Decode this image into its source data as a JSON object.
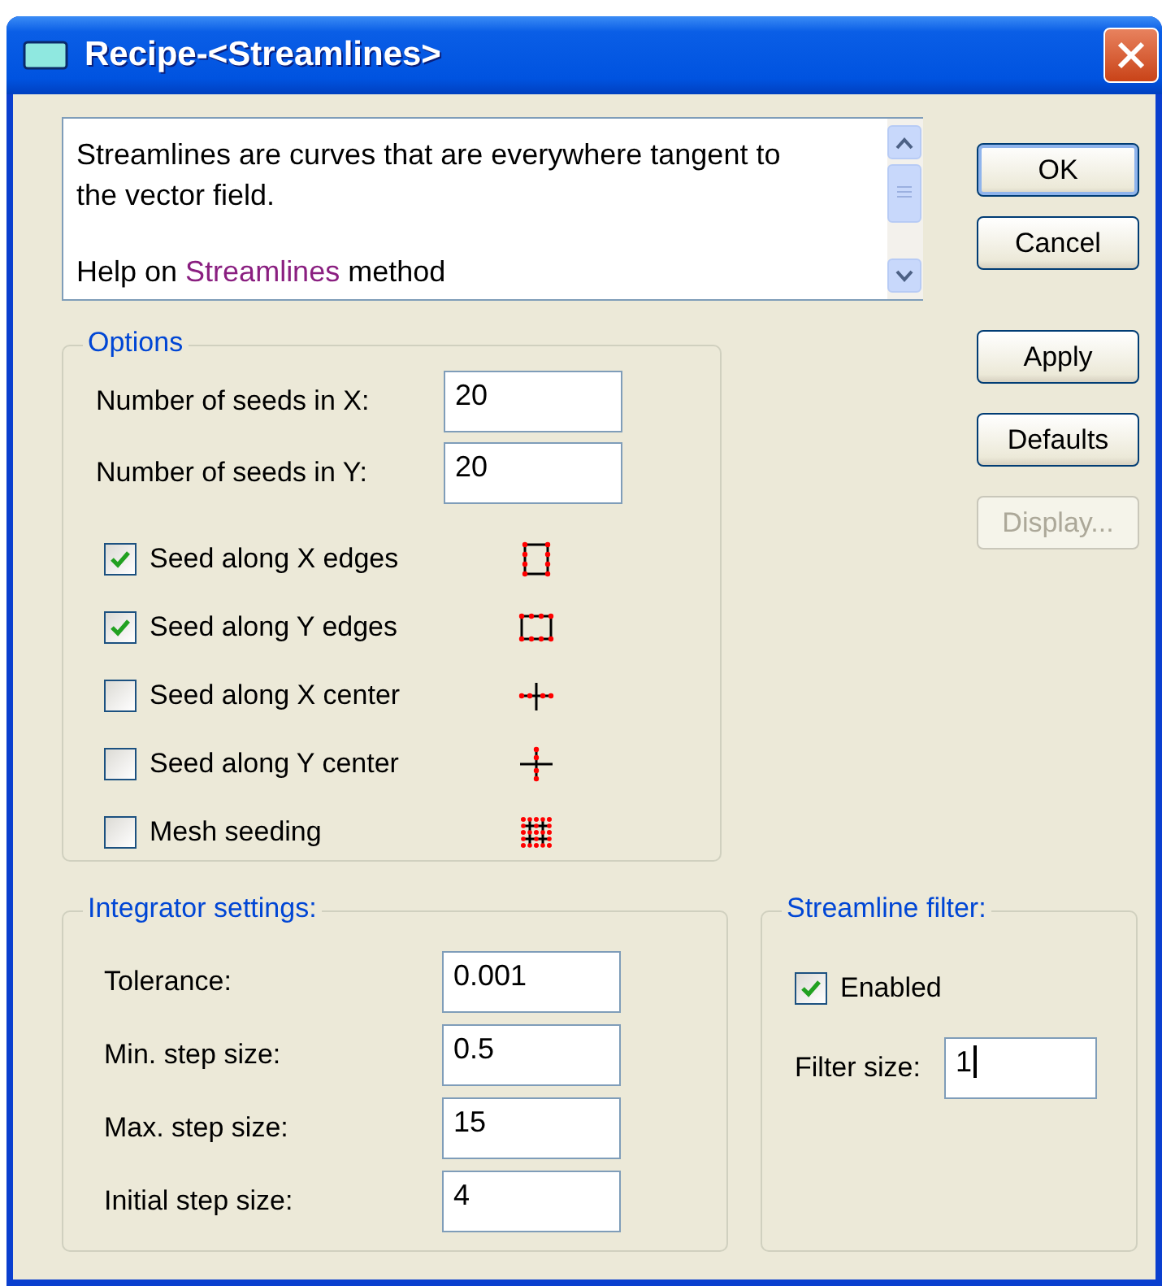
{
  "window": {
    "title": "Recipe-<Streamlines>"
  },
  "help": {
    "text": "Streamlines are curves that are everywhere tangent to the vector field.",
    "link_prefix": "Help on",
    "link": "Streamlines",
    "link_suffix": "method"
  },
  "buttons": [
    {
      "label": "OK",
      "default": true,
      "disabled": false
    },
    {
      "label": "Cancel",
      "default": false,
      "disabled": false
    },
    {
      "label": "Apply",
      "default": false,
      "disabled": false
    },
    {
      "label": "Defaults",
      "default": false,
      "disabled": false
    },
    {
      "label": "Display...",
      "default": false,
      "disabled": true
    }
  ],
  "options": {
    "title": "Options",
    "fields": [
      {
        "label": "Number of seeds in X:",
        "value": "20"
      },
      {
        "label": "Number of seeds in Y:",
        "value": "20"
      }
    ],
    "checks": [
      {
        "label": "Seed along X edges",
        "checked": true,
        "kind": "x-edges"
      },
      {
        "label": "Seed along Y edges",
        "checked": true,
        "kind": "y-edges"
      },
      {
        "label": "Seed along X center",
        "checked": false,
        "kind": "x-center"
      },
      {
        "label": "Seed along Y center",
        "checked": false,
        "kind": "y-center"
      },
      {
        "label": "Mesh seeding",
        "checked": false,
        "kind": "mesh"
      }
    ]
  },
  "integrator": {
    "title": "Integrator settings:",
    "fields": [
      {
        "label": "Tolerance:",
        "value": "0.001"
      },
      {
        "label": "Min. step size:",
        "value": "0.5"
      },
      {
        "label": "Max. step size:",
        "value": "15"
      },
      {
        "label": "Initial step size:",
        "value": "4"
      }
    ]
  },
  "filter": {
    "title": "Streamline filter:",
    "check": {
      "label": "Enabled",
      "checked": true
    },
    "field": {
      "label": "Filter size:",
      "value": "1",
      "focused": true
    }
  }
}
